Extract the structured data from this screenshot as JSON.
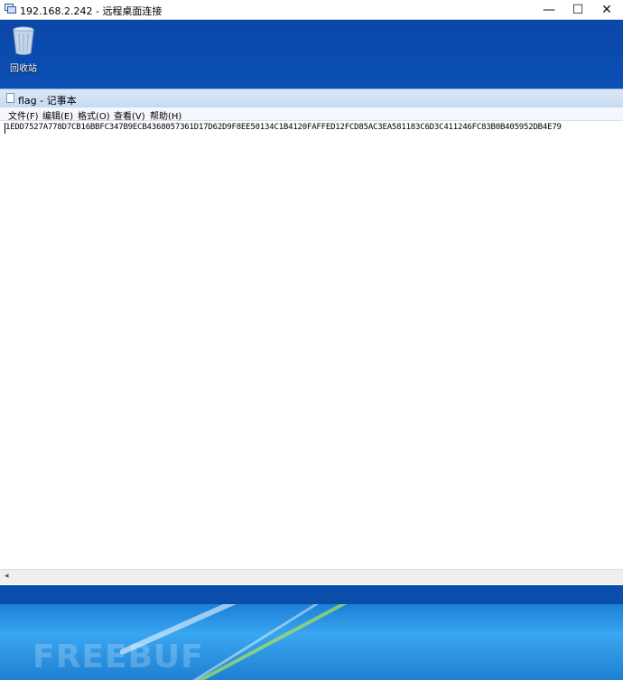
{
  "rdp": {
    "title": "192.168.2.242 - 远程桌面连接",
    "minimize": "—",
    "maximize": "☐",
    "close": "✕"
  },
  "desktop": {
    "icons": [
      {
        "label": "回收站",
        "icon": "recycle-bin-icon"
      },
      {
        "label": "",
        "icon": "chrome-icon"
      }
    ],
    "watermark": "FREEBUF"
  },
  "notepad": {
    "title": "flag - 记事本",
    "menu": [
      "文件(F)",
      "编辑(E)",
      "格式(O)",
      "查看(V)",
      "帮助(H)"
    ],
    "content": "1EDD7527A778D7CB16BBFC347B9ECB4368057361D17D62D9F8EE50134C1B4120FAFFED12FCD85AC3EA581183C6D3C411246FC83B0B405952DB4E79",
    "scroll_left_arrow": "◂"
  }
}
